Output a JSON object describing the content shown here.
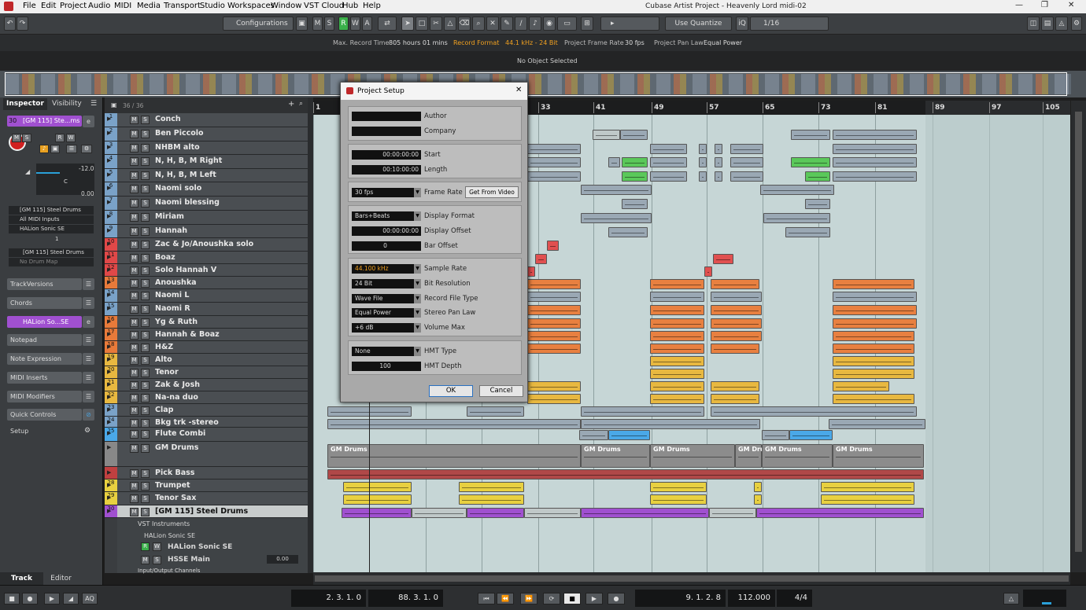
{
  "menubar": {
    "items": [
      "File",
      "Edit",
      "Project",
      "Audio",
      "MIDI",
      "Media",
      "Transport",
      "Studio",
      "Workspaces",
      "Window",
      "VST Cloud",
      "Hub",
      "Help"
    ],
    "title": "Cubase Artist Project - Heavenly Lord midi-02"
  },
  "toolbar": {
    "configurations": "Configurations",
    "ms": [
      "M",
      "S",
      "R",
      "W",
      "A"
    ],
    "quantize": "Use Quantize",
    "grid": "1/16"
  },
  "info": {
    "max_record_label": "Max. Record Time",
    "max_record": "805 hours 01 mins",
    "record_format_label": "Record Format",
    "record_format": "44.1 kHz - 24 Bit",
    "frame_rate_label": "Project Frame Rate",
    "frame_rate": "30 fps",
    "pan_law_label": "Project Pan Law",
    "pan_law": "Equal Power"
  },
  "no_object": "No Object Selected",
  "inspector": {
    "tab_inspector": "Inspector",
    "tab_visibility": "Visibility",
    "track_num": "30",
    "track_name": "[GM 115] Ste...ms",
    "volume": "-12.0",
    "pan": "C",
    "pan_val": "0.00",
    "routing": [
      "[GM 115] Steel Drums",
      "All MIDI Inputs",
      "HALion Sonic SE"
    ],
    "channel": "1",
    "program": "[GM 115] Steel Drums",
    "drum_map": "No Drum Map",
    "sections": [
      "TrackVersions",
      "Chords",
      "HALion So...SE",
      "Notepad",
      "Note Expression",
      "MIDI Inserts",
      "MIDI Modifiers",
      "Quick Controls",
      "Setup"
    ],
    "tab_track": "Track",
    "tab_editor": "Editor"
  },
  "tracklist": {
    "count": "36 / 36",
    "tracks": [
      {
        "n": "1",
        "name": "Conch",
        "color": "#7aa2c8"
      },
      {
        "n": "2",
        "name": "Ben Piccolo",
        "color": "#7aa2c8"
      },
      {
        "n": "3",
        "name": "NHBM alto",
        "color": "#7aa2c8"
      },
      {
        "n": "4",
        "name": "N, H, B, M Right",
        "color": "#7aa2c8"
      },
      {
        "n": "5",
        "name": "N, H, B, M Left",
        "color": "#7aa2c8"
      },
      {
        "n": "6",
        "name": "Naomi solo",
        "color": "#7aa2c8"
      },
      {
        "n": "7",
        "name": "Naomi blessing",
        "color": "#7aa2c8"
      },
      {
        "n": "8",
        "name": "Miriam",
        "color": "#7aa2c8"
      },
      {
        "n": "9",
        "name": "Hannah",
        "color": "#7aa2c8"
      },
      {
        "n": "10",
        "name": "Zac & Jo/Anoushka solo",
        "color": "#e04848"
      },
      {
        "n": "11",
        "name": "Boaz",
        "color": "#e04848"
      },
      {
        "n": "12",
        "name": "Solo Hannah V",
        "color": "#e04848"
      },
      {
        "n": "13",
        "name": "Anoushka",
        "color": "#e87a3a"
      },
      {
        "n": "14",
        "name": "Naomi L",
        "color": "#7aa2c8"
      },
      {
        "n": "15",
        "name": "Naomi R",
        "color": "#7aa2c8"
      },
      {
        "n": "16",
        "name": "Yg & Ruth",
        "color": "#e87a3a"
      },
      {
        "n": "17",
        "name": "Hannah & Boaz",
        "color": "#e87a3a"
      },
      {
        "n": "18",
        "name": "H&Z",
        "color": "#e87a3a"
      },
      {
        "n": "19",
        "name": "Alto",
        "color": "#e8b840"
      },
      {
        "n": "20",
        "name": "Tenor",
        "color": "#e8b840"
      },
      {
        "n": "21",
        "name": "Zak & Josh",
        "color": "#e8b840"
      },
      {
        "n": "22",
        "name": "Na-na duo",
        "color": "#e8b840"
      },
      {
        "n": "23",
        "name": "Clap",
        "color": "#7aa2c8"
      },
      {
        "n": "24",
        "name": "Bkg trk -stereo",
        "color": "#7aa2c8"
      },
      {
        "n": "25",
        "name": "Flute Combi",
        "color": "#4aa8e8"
      },
      {
        "n": "",
        "name": "GM Drums",
        "color": "#888888"
      },
      {
        "n": "",
        "name": "Pick Bass",
        "color": "#c04040"
      },
      {
        "n": "28",
        "name": "Trumpet",
        "color": "#e8d040"
      },
      {
        "n": "29",
        "name": "Tenor Sax",
        "color": "#e8d040"
      },
      {
        "n": "30",
        "name": "[GM 115] Steel Drums",
        "color": "#a050d0"
      }
    ],
    "folders": [
      "VST Instruments",
      "HALion Sonic SE",
      "HALion Sonic SE",
      "HSSE Main",
      "Input/Output Channels"
    ],
    "hsse_val": "0.00"
  },
  "ruler": {
    "bars": [
      "1",
      "33",
      "41",
      "49",
      "57",
      "65",
      "73",
      "81",
      "89",
      "97",
      "105"
    ]
  },
  "dialog": {
    "title": "Project Setup",
    "author_label": "Author",
    "company_label": "Company",
    "start": "00:00:00:00",
    "start_label": "Start",
    "length": "00:10:00:00",
    "length_label": "Length",
    "frame_rate": "30 fps",
    "frame_rate_label": "Frame Rate",
    "get_from_video": "Get From Video",
    "display_format": "Bars+Beats",
    "display_format_label": "Display Format",
    "display_offset": "00:00:00:00",
    "display_offset_label": "Display Offset",
    "bar_offset": "0",
    "bar_offset_label": "Bar Offset",
    "sample_rate": "44.100 kHz",
    "sample_rate_label": "Sample Rate",
    "bit_res": "24 Bit",
    "bit_res_label": "Bit Resolution",
    "file_type": "Wave File",
    "file_type_label": "Record File Type",
    "pan_law": "Equal Power",
    "pan_law_label": "Stereo Pan Law",
    "vol_max": "+6 dB",
    "vol_max_label": "Volume Max",
    "hmt_type": "None",
    "hmt_type_label": "HMT Type",
    "hmt_depth": "100",
    "hmt_depth_label": "HMT Depth",
    "ok": "OK",
    "cancel": "Cancel"
  },
  "transport": {
    "left_locator": "2. 3. 1. 0",
    "right_locator": "88. 3. 1. 0",
    "position": "9. 1. 2. 8",
    "tempo": "112.000",
    "signature": "4/4",
    "aq": "AQ"
  },
  "colors": {
    "accent": "#4a9fd8",
    "record": "#d02020",
    "orange": "#f0a020"
  }
}
